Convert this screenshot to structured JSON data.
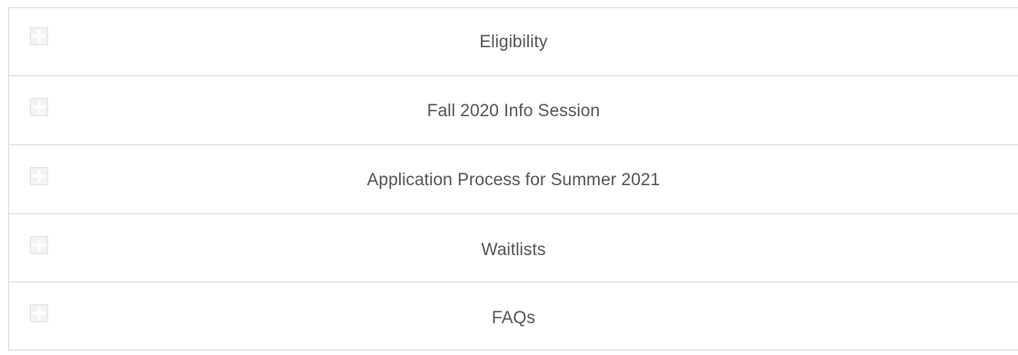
{
  "accordion": {
    "items": [
      {
        "title": "Eligibility",
        "icon": "plus-box-icon",
        "expanded": false
      },
      {
        "title": "Fall 2020 Info Session",
        "icon": "plus-box-icon",
        "expanded": false
      },
      {
        "title": "Application Process for Summer 2021",
        "icon": "plus-box-icon",
        "expanded": false
      },
      {
        "title": "Waitlists",
        "icon": "plus-box-icon",
        "expanded": false
      },
      {
        "title": "FAQs",
        "icon": "plus-box-icon",
        "expanded": false
      }
    ],
    "colors": {
      "border": "#dcdcdc",
      "text": "#555555",
      "icon_box": "#ececec",
      "icon_plus": "#ffffff"
    }
  }
}
